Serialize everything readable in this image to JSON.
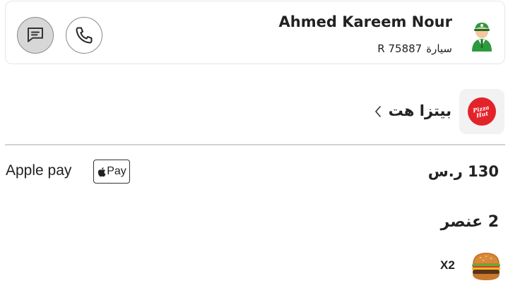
{
  "driver": {
    "name": "Ahmed Kareem Nour",
    "vehicle_label": "سيارة",
    "vehicle_plate": "R 75887"
  },
  "actions": {
    "chat_icon": "chat-bubble-icon",
    "call_icon": "phone-icon"
  },
  "store": {
    "name": "بيتزا هت",
    "logo_text_line1": "Pizza",
    "logo_text_line2": "Hut",
    "brand_color": "#e3232a"
  },
  "payment": {
    "method_label": "Apple pay",
    "badge_text": "Pay",
    "total": "130 ر.س"
  },
  "items": {
    "count_label": "2 عنصر",
    "list": [
      {
        "quantity": "X2",
        "image": "burger-icon"
      }
    ]
  }
}
